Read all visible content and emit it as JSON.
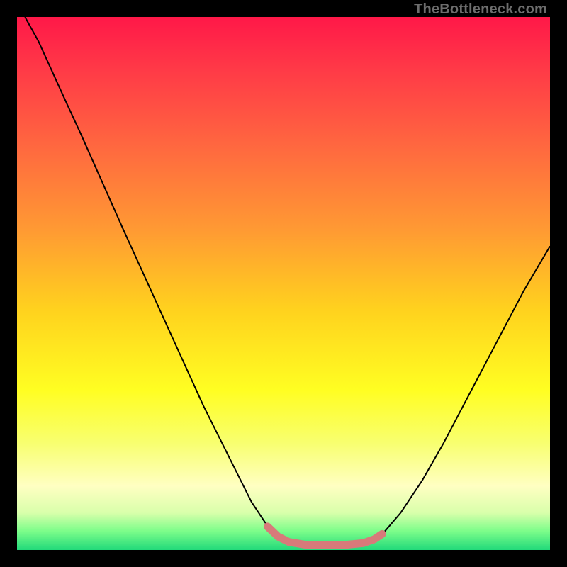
{
  "watermark": "TheBottleneck.com",
  "chart_data": {
    "type": "line",
    "title": "",
    "xlabel": "",
    "ylabel": "",
    "xlim": [
      0,
      100
    ],
    "ylim": [
      0,
      100
    ],
    "grid": false,
    "legend": "none",
    "annotations": [],
    "background_gradient": {
      "stops": [
        {
          "offset": 0.0,
          "color": "#ff1848"
        },
        {
          "offset": 0.1,
          "color": "#ff3a47"
        },
        {
          "offset": 0.25,
          "color": "#ff6a3f"
        },
        {
          "offset": 0.4,
          "color": "#ff9a33"
        },
        {
          "offset": 0.55,
          "color": "#ffd21e"
        },
        {
          "offset": 0.7,
          "color": "#fffe22"
        },
        {
          "offset": 0.8,
          "color": "#f8ff70"
        },
        {
          "offset": 0.88,
          "color": "#ffffc2"
        },
        {
          "offset": 0.93,
          "color": "#d9ffab"
        },
        {
          "offset": 0.965,
          "color": "#7bfd8a"
        },
        {
          "offset": 1.0,
          "color": "#21d97a"
        }
      ]
    },
    "series": [
      {
        "name": "bottleneck-curve",
        "stroke": "#000000",
        "stroke_width": 2,
        "points": [
          {
            "x": 1.5,
            "y": 100.0
          },
          {
            "x": 4.0,
            "y": 95.5
          },
          {
            "x": 5.0,
            "y": 93.3
          },
          {
            "x": 6.5,
            "y": 90.0
          },
          {
            "x": 9.0,
            "y": 84.5
          },
          {
            "x": 12.0,
            "y": 78.0
          },
          {
            "x": 16.0,
            "y": 69.0
          },
          {
            "x": 20.0,
            "y": 60.0
          },
          {
            "x": 25.0,
            "y": 49.0
          },
          {
            "x": 30.0,
            "y": 38.0
          },
          {
            "x": 35.0,
            "y": 27.0
          },
          {
            "x": 40.0,
            "y": 17.0
          },
          {
            "x": 44.0,
            "y": 9.0
          },
          {
            "x": 47.0,
            "y": 4.5
          },
          {
            "x": 49.0,
            "y": 2.5
          },
          {
            "x": 51.0,
            "y": 1.5
          },
          {
            "x": 54.0,
            "y": 1.0
          },
          {
            "x": 58.0,
            "y": 1.0
          },
          {
            "x": 62.0,
            "y": 1.0
          },
          {
            "x": 65.0,
            "y": 1.3
          },
          {
            "x": 67.0,
            "y": 2.0
          },
          {
            "x": 69.0,
            "y": 3.5
          },
          {
            "x": 72.0,
            "y": 7.0
          },
          {
            "x": 76.0,
            "y": 13.0
          },
          {
            "x": 80.0,
            "y": 20.0
          },
          {
            "x": 85.0,
            "y": 29.5
          },
          {
            "x": 90.0,
            "y": 39.0
          },
          {
            "x": 95.0,
            "y": 48.5
          },
          {
            "x": 100.0,
            "y": 57.0
          }
        ]
      },
      {
        "name": "bottom-band",
        "stroke": "#d77a7a",
        "stroke_width": 11,
        "linecap": "round",
        "points": [
          {
            "x": 47.0,
            "y": 4.4
          },
          {
            "x": 49.0,
            "y": 2.5
          },
          {
            "x": 51.0,
            "y": 1.5
          },
          {
            "x": 54.0,
            "y": 1.0
          },
          {
            "x": 58.0,
            "y": 1.0
          },
          {
            "x": 62.0,
            "y": 1.0
          },
          {
            "x": 65.0,
            "y": 1.3
          },
          {
            "x": 67.0,
            "y": 2.0
          },
          {
            "x": 68.5,
            "y": 3.0
          }
        ]
      }
    ]
  }
}
